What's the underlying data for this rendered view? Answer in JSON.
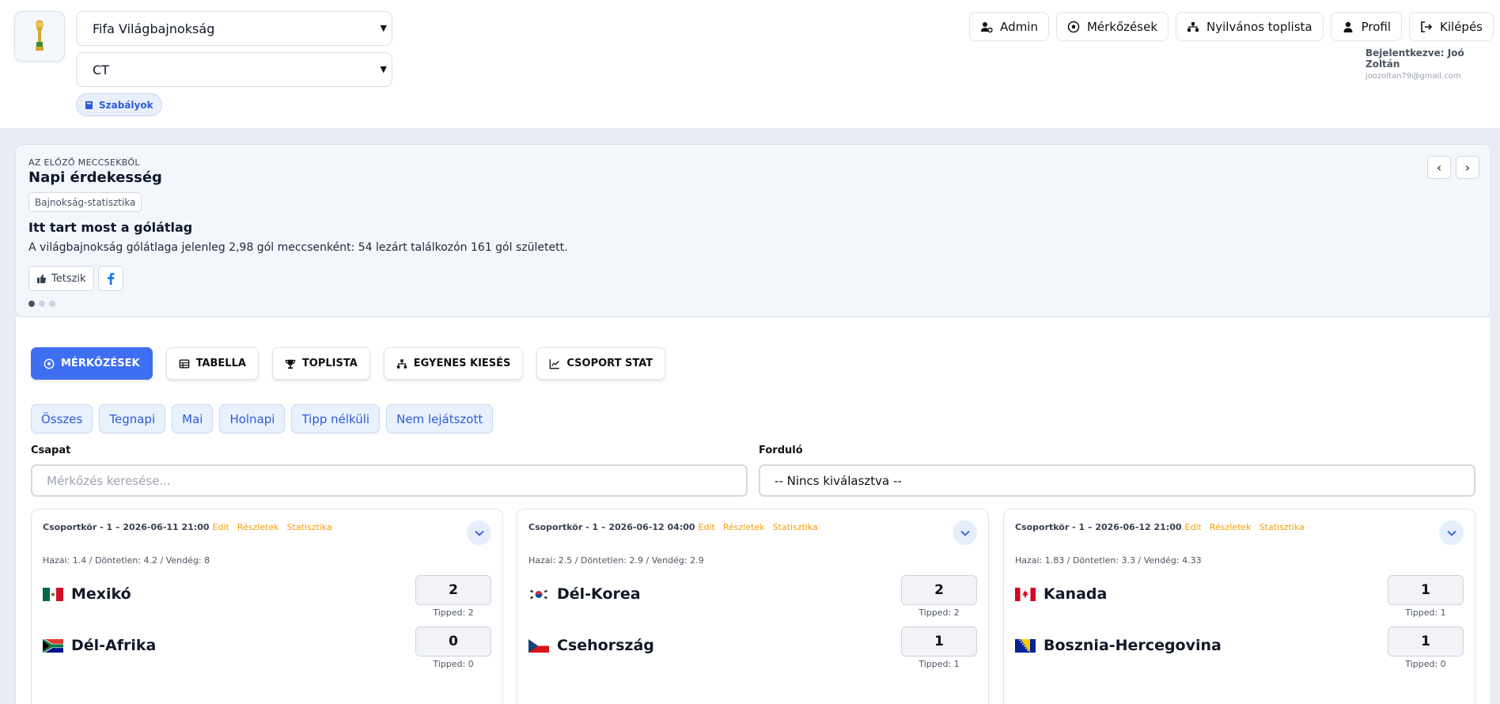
{
  "header": {
    "tournament_select": "Fifa Világbajnokság",
    "group_select": "CT",
    "rules_button": "Szabályok",
    "nav": [
      {
        "label": "Admin",
        "icon": "admin-user-icon"
      },
      {
        "label": "Mérkőzések",
        "icon": "soccer-ball-icon"
      },
      {
        "label": "Nyilvános toplista",
        "icon": "podium-icon"
      },
      {
        "label": "Profil",
        "icon": "user-icon"
      },
      {
        "label": "Kilépés",
        "icon": "logout-icon"
      }
    ],
    "logged_in": "Bejelentkezve: Joó Zoltán",
    "email": "joozoltan79@gmail.com"
  },
  "news": {
    "kicker": "AZ ELŐZŐ MECCSEKBŐL",
    "title": "Napi érdekesség",
    "tag": "Bajnokság-statisztika",
    "heading": "Itt tart most a gólátlag",
    "text": "A világbajnokság gólátlaga jelenleg 2,98 gól meccsenként: 54 lezárt találkozón 161 gól született.",
    "like_label": "Tetszik",
    "prev": "‹",
    "next": "›",
    "slide_count": 3,
    "active_slide": 1
  },
  "tabs": [
    {
      "label": "MÉRKŐZÉSEK",
      "icon": "soccer-ball-icon",
      "active": true
    },
    {
      "label": "TABELLA",
      "icon": "table-icon",
      "active": false
    },
    {
      "label": "TOPLISTA",
      "icon": "trophy-icon",
      "active": false
    },
    {
      "label": "EGYENES KIESÉS",
      "icon": "bracket-icon",
      "active": false
    },
    {
      "label": "CSOPORT STAT",
      "icon": "line-chart-icon",
      "active": false
    }
  ],
  "filters": [
    "Összes",
    "Tegnapi",
    "Mai",
    "Holnapi",
    "Tipp nélküli",
    "Nem lejátszott"
  ],
  "search": {
    "team_label": "Csapat",
    "team_placeholder": "Mérkőzés keresése...",
    "round_label": "Forduló",
    "round_value": "-- Nincs kiválasztva --"
  },
  "matches": [
    {
      "header": "Csoportkör - 1 – 2026-06-11 21:00",
      "edit": "Edit",
      "details": "Részletek",
      "stats": "Statisztika",
      "odds": "Hazai: 1.4 / Döntetlen: 4.2 / Vendég: 8",
      "home": {
        "name": "Mexikó",
        "flag": "mexico-flag",
        "score": "2",
        "tipped": "Tipped: 2"
      },
      "away": {
        "name": "Dél-Afrika",
        "flag": "south-africa-flag",
        "score": "0",
        "tipped": "Tipped: 0"
      }
    },
    {
      "header": "Csoportkör - 1 – 2026-06-12 04:00",
      "edit": "Edit",
      "details": "Részletek",
      "stats": "Statisztika",
      "odds": "Hazai: 2.5 / Döntetlen: 2.9 / Vendég: 2.9",
      "home": {
        "name": "Dél-Korea",
        "flag": "south-korea-flag",
        "score": "2",
        "tipped": "Tipped: 2"
      },
      "away": {
        "name": "Csehország",
        "flag": "czechia-flag",
        "score": "1",
        "tipped": "Tipped: 1"
      }
    },
    {
      "header": "Csoportkör - 1 – 2026-06-12 21:00",
      "edit": "Edit",
      "details": "Részletek",
      "stats": "Statisztika",
      "odds": "Hazai: 1.83 / Döntetlen: 3.3 / Vendég: 4.33",
      "home": {
        "name": "Kanada",
        "flag": "canada-flag",
        "score": "1",
        "tipped": "Tipped: 1"
      },
      "away": {
        "name": "Bosznia-Hercegovina",
        "flag": "bosnia-flag",
        "score": "1",
        "tipped": "Tipped: 0"
      }
    }
  ],
  "colors": {
    "accent": "#3e6ff0",
    "link_orange": "#f59e0b",
    "chip_bg": "#e9f1fd"
  }
}
